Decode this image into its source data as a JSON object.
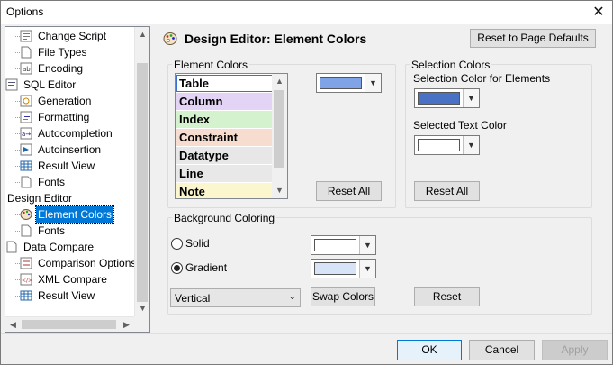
{
  "window": {
    "title": "Options",
    "close_icon": "close-icon"
  },
  "tree": {
    "items": [
      {
        "label": "Change Script",
        "icon": "script-icon",
        "level": 1
      },
      {
        "label": "File Types",
        "icon": "file-icon",
        "level": 1
      },
      {
        "label": "Encoding",
        "icon": "encoding-icon",
        "level": 1
      },
      {
        "label": "SQL Editor",
        "icon": "sql-editor-icon",
        "level": 0
      },
      {
        "label": "Generation",
        "icon": "generation-icon",
        "level": 1
      },
      {
        "label": "Formatting",
        "icon": "formatting-icon",
        "level": 1
      },
      {
        "label": "Autocompletion",
        "icon": "autocompletion-icon",
        "level": 1
      },
      {
        "label": "Autoinsertion",
        "icon": "autoinsertion-icon",
        "level": 1
      },
      {
        "label": "Result View",
        "icon": "grid-icon",
        "level": 1
      },
      {
        "label": "Fonts",
        "icon": "file-icon",
        "level": 1
      },
      {
        "label": "Design Editor",
        "icon": "",
        "level": 0
      },
      {
        "label": "Element Colors",
        "icon": "palette-icon",
        "level": 1,
        "selected": true
      },
      {
        "label": "Fonts",
        "icon": "file-icon",
        "level": 1
      },
      {
        "label": "Data Compare",
        "icon": "file-icon",
        "level": 0
      },
      {
        "label": "Comparison Options",
        "icon": "comparison-icon",
        "level": 1
      },
      {
        "label": "XML Compare",
        "icon": "xml-icon",
        "level": 1
      },
      {
        "label": "Result View",
        "icon": "grid-icon",
        "level": 1
      }
    ]
  },
  "page": {
    "title": "Design Editor: Element Colors",
    "reset_defaults_label": "Reset to Page Defaults"
  },
  "element_colors": {
    "legend": "Element Colors",
    "items": [
      {
        "label": "Table",
        "bg": "#ffffff",
        "selected": true
      },
      {
        "label": "Column",
        "bg": "#e3d4f5"
      },
      {
        "label": "Index",
        "bg": "#d5f2cf"
      },
      {
        "label": "Constraint",
        "bg": "#f7dcd0"
      },
      {
        "label": "Datatype",
        "bg": "#e7e7e7"
      },
      {
        "label": "Line",
        "bg": "#e8e8e8"
      },
      {
        "label": "Note",
        "bg": "#fcf6cf"
      }
    ],
    "color_value": "#7fa3e6",
    "reset_all_label": "Reset All"
  },
  "selection_colors": {
    "legend": "Selection Colors",
    "elements_label": "Selection Color for Elements",
    "elements_color": "#4a72c4",
    "text_label": "Selected Text Color",
    "text_color": "#ffffff",
    "reset_all_label": "Reset All"
  },
  "background": {
    "legend": "Background Coloring",
    "solid_label": "Solid",
    "solid_color": "#ffffff",
    "gradient_label": "Gradient",
    "gradient_color": "#d7e3f7",
    "gradient_checked": true,
    "direction_value": "Vertical",
    "swap_label": "Swap Colors",
    "reset_label": "Reset"
  },
  "footer": {
    "ok_label": "OK",
    "cancel_label": "Cancel",
    "apply_label": "Apply"
  }
}
